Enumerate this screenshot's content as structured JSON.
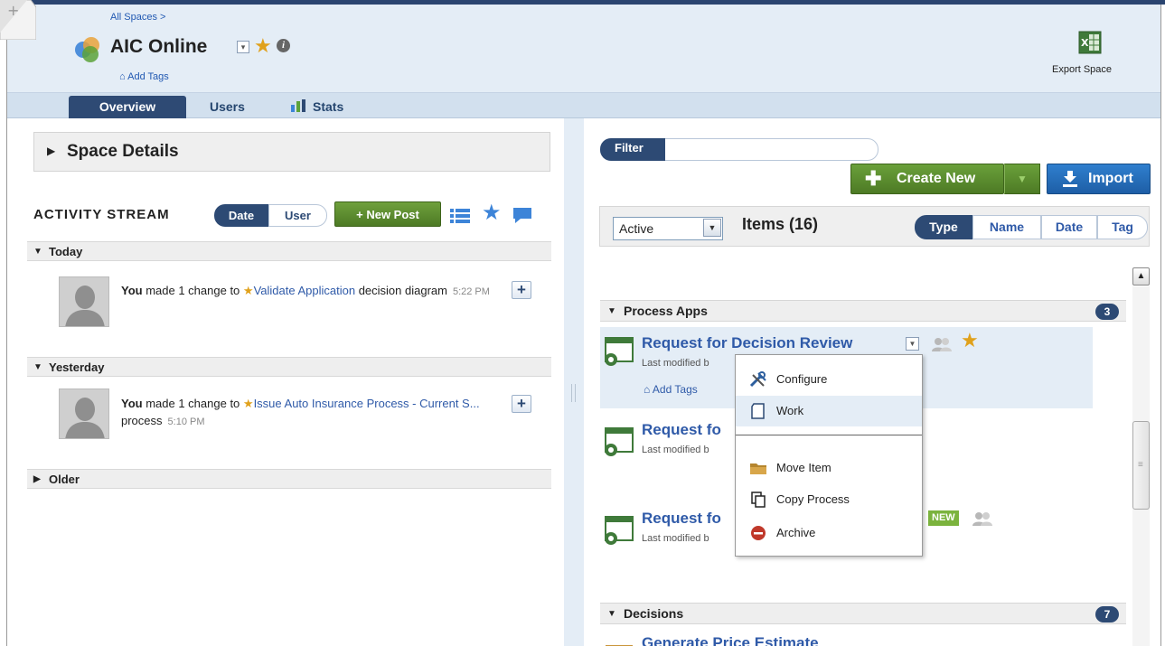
{
  "header": {
    "breadcrumb": "All Spaces >",
    "space_title": "AIC Online",
    "add_tags": "Add Tags",
    "export_label": "Export Space"
  },
  "tabs": {
    "overview": "Overview",
    "users": "Users",
    "stats": "Stats"
  },
  "left": {
    "space_details": "Space Details",
    "activity_title": "ACTIVITY STREAM",
    "seg_date": "Date",
    "seg_user": "User",
    "new_post": "+ New Post",
    "groups": {
      "today": "Today",
      "yesterday": "Yesterday",
      "older": "Older"
    },
    "activities": [
      {
        "actor": "You",
        "verb": " made 1 change to ",
        "link": "Validate Application",
        "rest": " decision diagram",
        "time": "5:22 PM"
      },
      {
        "actor": "You",
        "verb": " made 1 change to ",
        "link": "Issue Auto Insurance Process - Current S...",
        "rest": " process",
        "time": "5:10 PM"
      }
    ]
  },
  "right": {
    "filter_label": "Filter",
    "filter_value": "",
    "create_new": "Create New",
    "import": "Import",
    "status_value": "Active",
    "items_count": "Items (16)",
    "sort": {
      "type": "Type",
      "name": "Name",
      "date": "Date",
      "tag": "Tag"
    },
    "sections": {
      "process_apps": {
        "label": "Process Apps",
        "count": "3"
      },
      "decisions": {
        "label": "Decisions",
        "count": "7"
      }
    },
    "items": [
      {
        "title": "Request for Decision Review",
        "sub": "Last modified b",
        "tags": "Add Tags"
      },
      {
        "title": "Request fo",
        "sub": "Last modified b"
      },
      {
        "title": "Request fo",
        "sub": "Last modified b",
        "badge": "NEW"
      },
      {
        "title": "Generate Price Estimate"
      }
    ],
    "menu": {
      "configure": "Configure",
      "work": "Work",
      "move": "Move Item",
      "copy": "Copy Process",
      "archive": "Archive"
    }
  },
  "colors": {
    "navy": "#2d4a74",
    "link_blue": "#2f5aa8",
    "green": "#5b8c2e",
    "star_gold": "#e0a11b",
    "import_blue": "#1e5ea6"
  }
}
